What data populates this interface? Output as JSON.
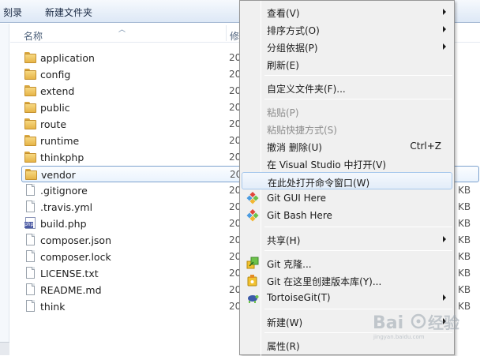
{
  "toolbar": {
    "burn": "刻录",
    "new_folder": "新建文件夹"
  },
  "columns": {
    "name": "名称",
    "modified": "修"
  },
  "files": [
    {
      "name": "application",
      "type": "folder",
      "mod": "20",
      "size": ""
    },
    {
      "name": "config",
      "type": "folder",
      "mod": "20",
      "size": ""
    },
    {
      "name": "extend",
      "type": "folder",
      "mod": "20",
      "size": ""
    },
    {
      "name": "public",
      "type": "folder",
      "mod": "20",
      "size": ""
    },
    {
      "name": "route",
      "type": "folder",
      "mod": "20",
      "size": ""
    },
    {
      "name": "runtime",
      "type": "folder",
      "mod": "20",
      "size": ""
    },
    {
      "name": "thinkphp",
      "type": "folder",
      "mod": "20",
      "size": ""
    },
    {
      "name": "vendor",
      "type": "folder",
      "mod": "20",
      "size": "",
      "selected": true
    },
    {
      "name": ".gitignore",
      "type": "file",
      "mod": "20",
      "size": "KB"
    },
    {
      "name": ".travis.yml",
      "type": "file",
      "mod": "20",
      "size": "KB"
    },
    {
      "name": "build.php",
      "type": "php",
      "mod": "20",
      "size": "KB"
    },
    {
      "name": "composer.json",
      "type": "file",
      "mod": "20",
      "size": "KB"
    },
    {
      "name": "composer.lock",
      "type": "file",
      "mod": "20",
      "size": "KB"
    },
    {
      "name": "LICENSE.txt",
      "type": "file",
      "mod": "20",
      "size": "KB"
    },
    {
      "name": "README.md",
      "type": "file",
      "mod": "20",
      "size": "KB"
    },
    {
      "name": "think",
      "type": "file",
      "mod": "20",
      "size": "KB"
    }
  ],
  "menu": {
    "items": [
      {
        "id": "view",
        "label": "查看(V)",
        "submenu": true
      },
      {
        "id": "sort",
        "label": "排序方式(O)",
        "submenu": true
      },
      {
        "id": "group",
        "label": "分组依据(P)",
        "submenu": true
      },
      {
        "id": "refresh",
        "label": "刷新(E)"
      },
      {
        "sep": true
      },
      {
        "id": "customize",
        "label": "自定义文件夹(F)..."
      },
      {
        "sep": true
      },
      {
        "id": "paste",
        "label": "粘贴(P)",
        "disabled": true
      },
      {
        "id": "paste-shortcut",
        "label": "粘贴快捷方式(S)",
        "disabled": true
      },
      {
        "id": "undo-delete",
        "label": "撤消 删除(U)",
        "shortcut": "Ctrl+Z"
      },
      {
        "id": "open-vs",
        "label": "在 Visual Studio 中打开(V)"
      },
      {
        "id": "open-cmd",
        "label": "在此处打开命令窗口(W)",
        "highlighted": true
      },
      {
        "id": "git-gui",
        "label": "Git GUI Here",
        "icon": "git-diamond-icon"
      },
      {
        "id": "git-bash",
        "label": "Git Bash Here",
        "icon": "git-diamond-icon"
      },
      {
        "sep": true
      },
      {
        "id": "share",
        "label": "共享(H)",
        "submenu": true
      },
      {
        "sep": true
      },
      {
        "id": "git-clone",
        "label": "Git 克隆...",
        "icon": "git-clone-icon"
      },
      {
        "id": "git-create-repo",
        "label": "Git 在这里创建版本库(Y)...",
        "icon": "git-repo-icon"
      },
      {
        "id": "tortoisegit",
        "label": "TortoiseGit(T)",
        "icon": "tortoise-icon",
        "submenu": true
      },
      {
        "sep": true
      },
      {
        "id": "new",
        "label": "新建(W)",
        "submenu": true
      },
      {
        "sep": true
      },
      {
        "id": "properties",
        "label": "属性(R)"
      }
    ]
  },
  "colors": {
    "accent": "#a8c8ec",
    "folder": "#e6b447",
    "menu_bg": "#f0f0f0"
  }
}
